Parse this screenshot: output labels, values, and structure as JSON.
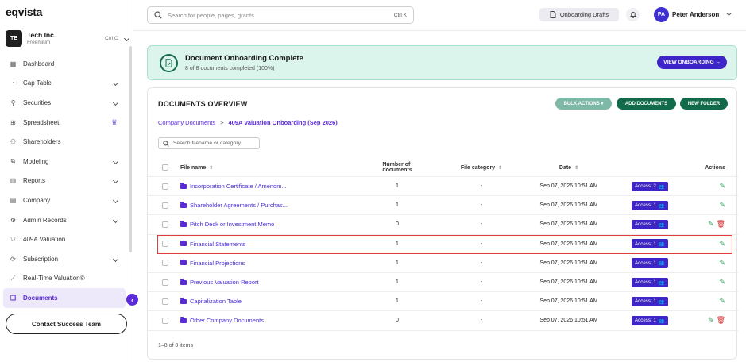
{
  "app": {
    "logo": "eqvista"
  },
  "org": {
    "initials": "TE",
    "name": "Tech Inc",
    "plan": "Freemium",
    "shortcut": "Ctrl O"
  },
  "sidebar": {
    "items": [
      {
        "label": "Dashboard",
        "icon": "dashboard-icon",
        "chevron": false
      },
      {
        "label": "Cap Table",
        "icon": "cap-table-icon",
        "chevron": true
      },
      {
        "label": "Securities",
        "icon": "securities-icon",
        "chevron": true
      },
      {
        "label": "Spreadsheet",
        "icon": "spreadsheet-icon",
        "chevron": false,
        "crown": true
      },
      {
        "label": "Shareholders",
        "icon": "shareholders-icon",
        "chevron": false
      },
      {
        "label": "Modeling",
        "icon": "modeling-icon",
        "chevron": true
      },
      {
        "label": "Reports",
        "icon": "reports-icon",
        "chevron": true
      },
      {
        "label": "Company",
        "icon": "company-icon",
        "chevron": true
      },
      {
        "label": "Admin Records",
        "icon": "admin-records-icon",
        "chevron": true
      },
      {
        "label": "409A Valuation",
        "icon": "shield-icon",
        "chevron": false
      },
      {
        "label": "Subscription",
        "icon": "subscription-icon",
        "chevron": true
      },
      {
        "label": "Real-Time Valuation®",
        "icon": "chart-line-icon",
        "chevron": false
      },
      {
        "label": "Documents",
        "icon": "documents-icon",
        "chevron": false,
        "active": true
      }
    ],
    "contact_label": "Contact Success Team"
  },
  "header": {
    "search_placeholder": "Search for people, pages, grants",
    "search_shortcut": "Ctrl K",
    "drafts_label": "Onboarding Drafts",
    "user_initials": "PA",
    "user_name": "Peter Anderson"
  },
  "banner": {
    "title": "Document Onboarding Complete",
    "subtitle": "8 of 8 documents completed (100%)",
    "button_label": "VIEW ONBOARDING →",
    "bg_color": "#dcf5ec"
  },
  "documents": {
    "title": "DOCUMENTS OVERVIEW",
    "bulk_label": "BULK ACTIONS ▾",
    "add_label": "ADD DOCUMENTS",
    "folder_label": "NEW FOLDER",
    "breadcrumb": {
      "root": "Company Documents",
      "current": "409A Valuation Onboarding (Sep 2026)"
    },
    "search_placeholder": "Search filename or category",
    "columns": {
      "name": "File name",
      "count": "Number of documents",
      "category": "File category",
      "date": "Date",
      "actions": "Actions"
    },
    "rows": [
      {
        "name": "Incorporation Certificate / Amendm...",
        "count": "1",
        "category": "-",
        "date": "Sep 07, 2026 10:51 AM",
        "access": "Access: 2",
        "delete": false
      },
      {
        "name": "Shareholder Agreements / Purchas...",
        "count": "1",
        "category": "-",
        "date": "Sep 07, 2026 10:51 AM",
        "access": "Access: 1",
        "delete": false
      },
      {
        "name": "Pitch Deck or Investment Memo",
        "count": "0",
        "category": "-",
        "date": "Sep 07, 2026 10:51 AM",
        "access": "Access: 1",
        "delete": true
      },
      {
        "name": "Financial Statements",
        "count": "1",
        "category": "-",
        "date": "Sep 07, 2026 10:51 AM",
        "access": "Access: 1",
        "delete": false,
        "highlight": true
      },
      {
        "name": "Financial Projections",
        "count": "1",
        "category": "-",
        "date": "Sep 07, 2026 10:51 AM",
        "access": "Access: 1",
        "delete": false
      },
      {
        "name": "Previous Valuation Report",
        "count": "1",
        "category": "-",
        "date": "Sep 07, 2026 10:51 AM",
        "access": "Access: 1",
        "delete": false
      },
      {
        "name": "Capitalization Table",
        "count": "1",
        "category": "-",
        "date": "Sep 07, 2026 10:51 AM",
        "access": "Access: 1",
        "delete": false
      },
      {
        "name": "Other Company Documents",
        "count": "0",
        "category": "-",
        "date": "Sep 07, 2026 10:51 AM",
        "access": "Access: 1",
        "delete": true
      }
    ],
    "footer": "1–8 of 8 items"
  },
  "colors": {
    "primary": "#3d25c8",
    "accent_green": "#116b4b",
    "highlight_border": "#e23b3b"
  }
}
